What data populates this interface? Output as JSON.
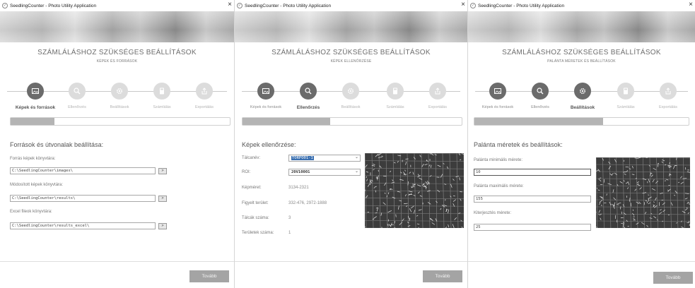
{
  "app": {
    "title": "SeedlingCounter - Photo Utility Application",
    "close": "×"
  },
  "header": {
    "title": "SZÁMLÁLÁSHOZ SZÜKSÉGES BEÁLLÍTÁSOK"
  },
  "steps": [
    "Képek és források",
    "Ellenőrzés",
    "Beállítások",
    "Számlálás",
    "Exportálás"
  ],
  "next_button": "Tovább",
  "window1": {
    "subtitle": "KÉPEK ÉS FORRÁSOK",
    "section_title": "Források és útvonalak beállítása:",
    "progress": 0.2,
    "fields": [
      {
        "label": "Forrás képek könyvtára:",
        "value": "C:\\SeedlingCounter\\images\\",
        "button": ">"
      },
      {
        "label": "Módosított képek könyvtára:",
        "value": "C:\\SeedlingCounter\\results\\",
        "button": ">"
      },
      {
        "label": "Excel fileok könyvtára:",
        "value": "C:\\SeedlingCounter\\results_excel\\",
        "button": ">"
      }
    ]
  },
  "window2": {
    "subtitle": "KÉPEK ELLENŐRZÉSE",
    "section_title": "Képek ellenőrzése:",
    "progress": 0.4,
    "talca_label": "Tálcanév:",
    "talca_value": "TORPO01-1",
    "roi_label": "ROI:",
    "roi_value": "20V10001",
    "rows": [
      {
        "label": "Képméret:",
        "value": "3134-2321"
      },
      {
        "label": "Figyelt terület:",
        "value": "332-476, 2972-1888"
      },
      {
        "label": "Tálcák száma:",
        "value": "3"
      },
      {
        "label": "Területek száma:",
        "value": "1"
      }
    ]
  },
  "window3": {
    "subtitle": "PALÁNTA MÉRETEK ÉS BEÁLLÍTÁSOK",
    "section_title": "Palánta méretek és beállítások:",
    "progress": 0.6,
    "fields": [
      {
        "label": "Palánta minimális mérete:",
        "value": "10"
      },
      {
        "label": "Palánta maximális mérete:",
        "value": "155"
      },
      {
        "label": "Kiterjesztés mérete:",
        "value": "25"
      }
    ]
  }
}
